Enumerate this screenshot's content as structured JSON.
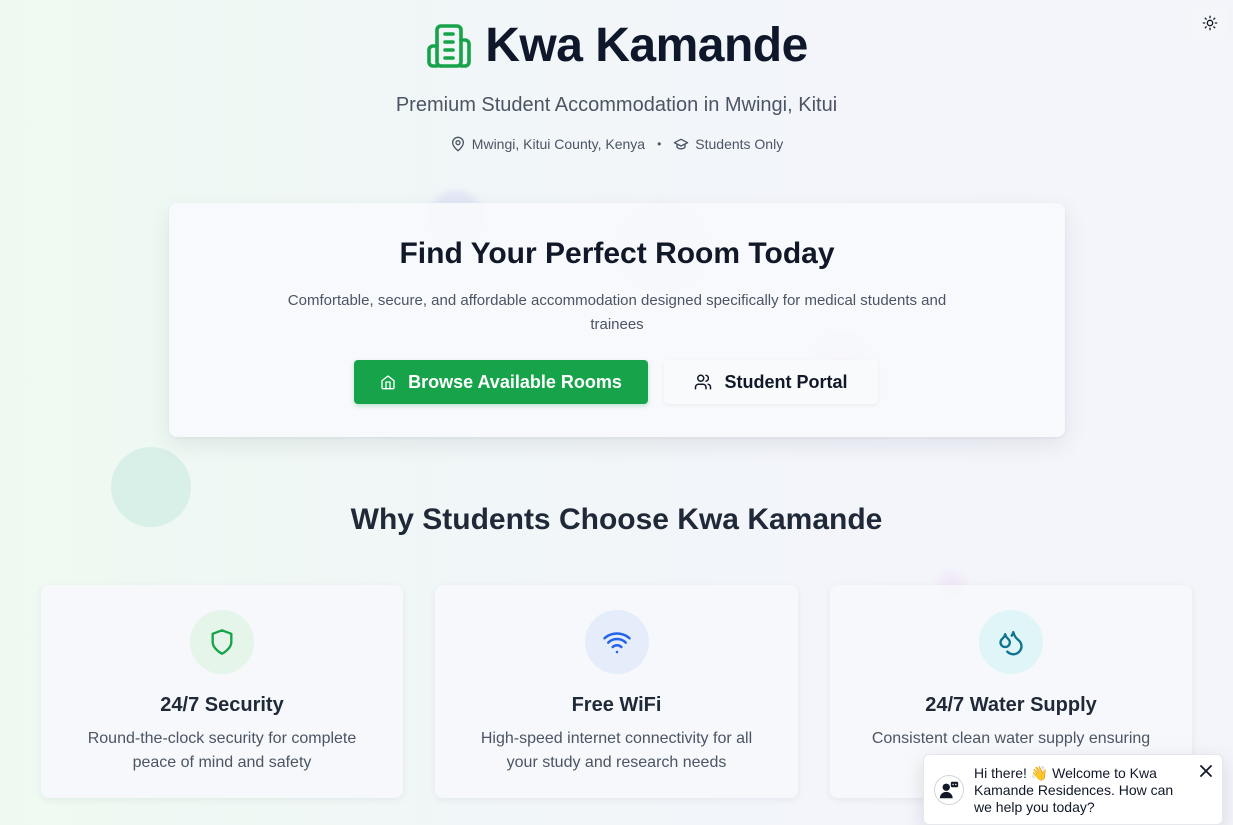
{
  "header": {
    "brand_name": "Kwa Kamande",
    "tagline": "Premium Student Accommodation in Mwingi, Kitui",
    "location": "Mwingi, Kitui County, Kenya",
    "separator": "•",
    "audience": "Students Only"
  },
  "hero": {
    "title": "Find Your Perfect Room Today",
    "description": "Comfortable, secure, and affordable accommodation designed specifically for medical students and trainees",
    "primary_button": "Browse Available Rooms",
    "secondary_button": "Student Portal"
  },
  "features": {
    "section_title": "Why Students Choose Kwa Kamande",
    "items": [
      {
        "icon": "shield-icon",
        "title": "24/7 Security",
        "description": "Round-the-clock security for complete peace of mind and safety",
        "color": "#16a34a",
        "bg": "#e6f5ea"
      },
      {
        "icon": "wifi-icon",
        "title": "Free WiFi",
        "description": "High-speed internet connectivity for all your study and research needs",
        "color": "#2563eb",
        "bg": "#e5ecfa"
      },
      {
        "icon": "droplets-icon",
        "title": "24/7 Water Supply",
        "description": "Consistent clean water supply ensuring",
        "color": "#0e7490",
        "bg": "#e0f5f8"
      }
    ]
  },
  "chat": {
    "message": "Hi there! 👋 Welcome to Kwa Kamande Residences. How can we help you today?"
  },
  "colors": {
    "accent": "#16a34a",
    "text_dark": "#0f172a",
    "text_muted": "#4b5563"
  }
}
